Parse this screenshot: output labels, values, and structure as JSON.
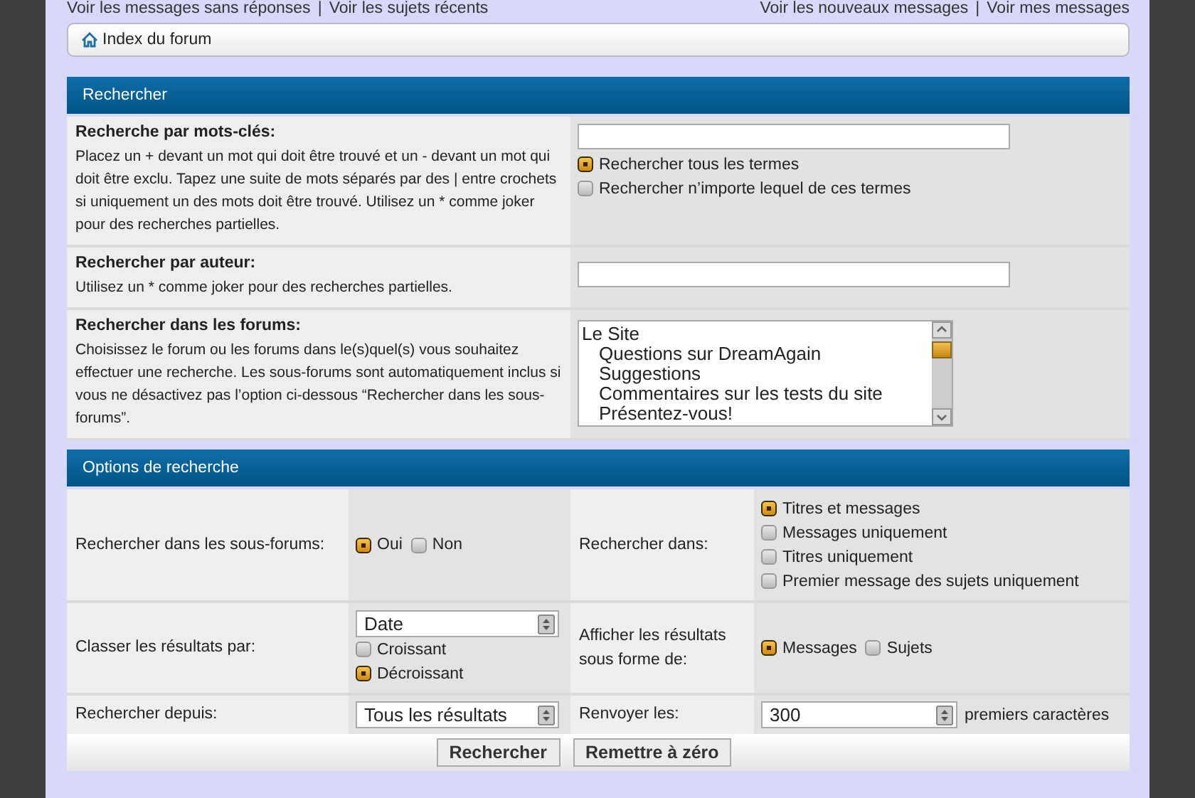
{
  "top_links": {
    "separator": "|",
    "left": [
      "Voir les messages sans réponses",
      "Voir les sujets récents"
    ],
    "right": [
      "Voir les nouveaux messages",
      "Voir mes messages"
    ]
  },
  "breadcrumb": "Index du forum",
  "search_section": {
    "title": "Rechercher",
    "rows": [
      {
        "kind": "keywords",
        "label": "Recherche par mots-clés:",
        "description": "Placez un + devant un mot qui doit être trouvé et un - devant un mot qui doit être exclu. Tapez une suite de mots séparés par des | entre crochets si uniquement un des mots doit être trouvé. Utilisez un * comme joker pour des recherches partielles.",
        "options": [
          {
            "label": "Rechercher tous les termes",
            "selected": true
          },
          {
            "label": "Rechercher n’importe lequel de ces termes",
            "selected": false
          }
        ]
      },
      {
        "kind": "text",
        "label": "Rechercher par auteur:",
        "description": "Utilisez un * comme joker pour des recherches partielles."
      },
      {
        "kind": "listbox",
        "label": "Rechercher dans les forums:",
        "description": "Choisissez le forum ou les forums dans le(s)quel(s) vous souhaitez effectuer une recherche. Les sous-forums sont automatiquement inclus si vous ne désactivez pas l’option ci-dessous “Rechercher dans les sous-forums”.",
        "items": [
          {
            "label": "Le Site",
            "children": [
              {
                "label": "Questions sur DreamAgain"
              },
              {
                "label": "Suggestions"
              },
              {
                "label": "Commentaires sur les tests du site"
              },
              {
                "label": "Présentez-vous!"
              }
            ]
          }
        ]
      }
    ]
  },
  "options_section": {
    "title": "Options de recherche",
    "rows": [
      {
        "cells": [
          {
            "label": "Rechercher dans les sous-forums:",
            "control": {
              "kind": "radios_inline",
              "options": [
                {
                  "label": "Oui",
                  "selected": true
                },
                {
                  "label": "Non",
                  "selected": false
                }
              ]
            }
          },
          {
            "label": "Rechercher dans:",
            "control": {
              "kind": "radios_stacked",
              "options": [
                {
                  "label": "Titres et messages",
                  "selected": true
                },
                {
                  "label": "Messages uniquement",
                  "selected": false
                },
                {
                  "label": "Titres uniquement",
                  "selected": false
                },
                {
                  "label": "Premier message des sujets uniquement",
                  "selected": false
                }
              ]
            }
          }
        ]
      },
      {
        "cells": [
          {
            "label": "Classer les résultats par:",
            "control": {
              "kind": "select_radios",
              "select": "Date",
              "options": [
                {
                  "label": "Croissant",
                  "selected": false
                },
                {
                  "label": "Décroissant",
                  "selected": true
                }
              ]
            }
          },
          {
            "label": "Afficher les résultats sous forme de:",
            "control": {
              "kind": "radios_inline",
              "options": [
                {
                  "label": "Messages",
                  "selected": true
                },
                {
                  "label": "Sujets",
                  "selected": false
                }
              ]
            }
          }
        ]
      },
      {
        "cells": [
          {
            "label": "Rechercher depuis:",
            "control": {
              "kind": "select",
              "select": "Tous les résultats"
            }
          },
          {
            "label": "Renvoyer les:",
            "control": {
              "kind": "select",
              "select": "300",
              "suffix": "premiers caractères"
            }
          }
        ]
      }
    ]
  },
  "buttons": [
    "Rechercher",
    "Remettre à zéro"
  ]
}
